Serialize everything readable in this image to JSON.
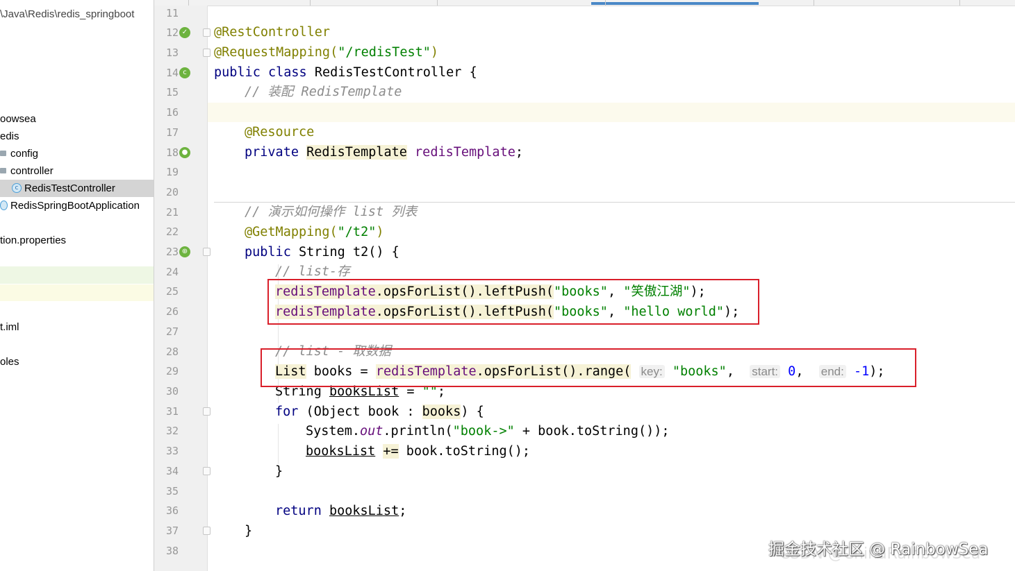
{
  "sidebar": {
    "path": "\\Java\\Redis\\redis_springboot",
    "items": [
      {
        "label": "oowsea"
      },
      {
        "label": "edis"
      },
      {
        "label": "config"
      },
      {
        "label": "controller"
      },
      {
        "label": "RedisTestController"
      },
      {
        "label": "RedisSpringBootApplication"
      },
      {
        "label": "tion.properties"
      },
      {
        "label": "t.iml"
      },
      {
        "label": "oles"
      }
    ]
  },
  "gutter": {
    "line_numbers": [
      "11",
      "12",
      "13",
      "14",
      "15",
      "16",
      "17",
      "18",
      "19",
      "20",
      "21",
      "22",
      "23",
      "24",
      "25",
      "26",
      "27",
      "28",
      "29",
      "30",
      "31",
      "32",
      "33",
      "34",
      "35",
      "36",
      "37",
      "38"
    ]
  },
  "code": {
    "l12": "@RestController",
    "l13_ann": "@RequestMapping(",
    "l13_str": "\"/redisTest\"",
    "l13_end": ")",
    "l14_kw1": "public",
    "l14_kw2": "class",
    "l14_rest": "RedisTestController {",
    "l15": "// 装配 RedisTemplate",
    "l17": "@Resource",
    "l18_kw": "private",
    "l18_type": "RedisTemplate",
    "l18_field": "redisTemplate",
    "l18_end": ";",
    "l21": "// 演示如何操作 list 列表",
    "l22_ann": "@GetMapping(",
    "l22_str": "\"/t2\"",
    "l22_end": ")",
    "l23_kw": "public",
    "l23_type": "String",
    "l23_rest": "t2() {",
    "l24": "// list-存",
    "l25_field": "redisTemplate",
    "l25_call": ".opsForList().leftPush(",
    "l25_str1": "\"books\"",
    "l25_comma": ", ",
    "l25_str2": "\"笑傲江湖\"",
    "l25_end": ");",
    "l26_field": "redisTemplate",
    "l26_call": ".opsForList().leftPush(",
    "l26_str1": "\"books\"",
    "l26_comma": ", ",
    "l26_str2": "\"hello world\"",
    "l26_end": ");",
    "l28": "// list - 取数据",
    "l29_type": "List",
    "l29_var": " books = ",
    "l29_field": "redisTemplate",
    "l29_call": ".opsForList().range(",
    "l29_hint_key": "key:",
    "l29_str": "\"books\"",
    "l29_hint_start": "start:",
    "l29_num0": "0",
    "l29_hint_end": "end:",
    "l29_num1": "-1",
    "l29_end": ");",
    "l30_type": "String ",
    "l30_var": "booksList",
    "l30_eq": " = ",
    "l30_str": "\"\"",
    "l30_end": ";",
    "l31_kw": "for",
    "l31_mid": " (Object book : ",
    "l31_var": "books",
    "l31_end": ") {",
    "l32_sys": "System.",
    "l32_out": "out",
    "l32_call": ".println(",
    "l32_str": "\"book->\"",
    "l32_end": " + book.toString());",
    "l33_var": "booksList",
    "l33_op": "+=",
    "l33_end": " book.toString();",
    "l34": "}",
    "l36_kw": "return",
    "l36_var": "booksList",
    "l36_end": ";",
    "l37": "}"
  },
  "watermark": {
    "line1": "掘金技术社区 @ RainbowSea",
    "line2": "CSDN @ChinaRainbowSea"
  },
  "colors": {
    "keyword": "#000080",
    "annotation": "#808000",
    "string": "#008000",
    "field": "#660e7a",
    "comment": "#8c8c8c",
    "highlight_box": "#d91f2a"
  }
}
